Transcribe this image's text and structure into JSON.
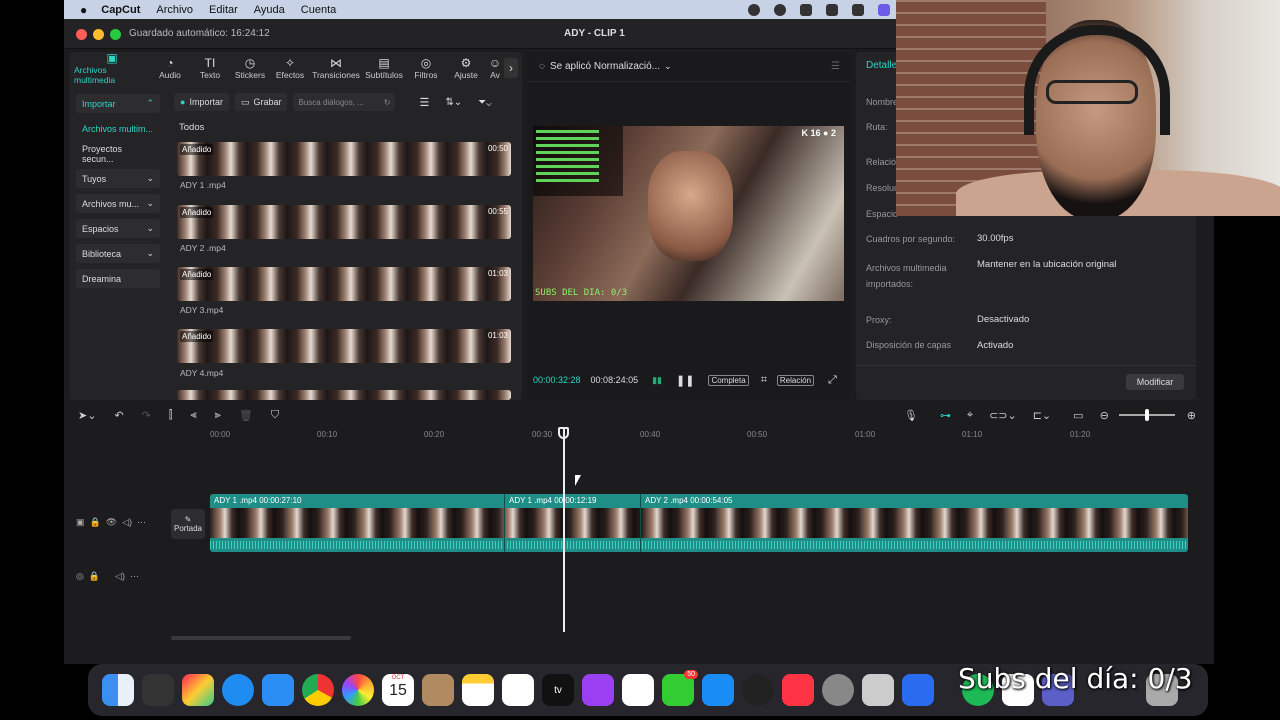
{
  "menubar": {
    "app": "CapCut",
    "items": [
      "Archivo",
      "Editar",
      "Ayuda",
      "Cuenta"
    ]
  },
  "window": {
    "autosave": "Guardado automático: 16:24:12",
    "title": "ADY - CLIP 1",
    "colors": {
      "close": "#ff5f57",
      "min": "#febc2e",
      "max": "#28c840",
      "accent": "#2fd3c5"
    }
  },
  "toolbar": {
    "items": [
      {
        "label": "Archivos multimedia",
        "icon": "media-icon",
        "glyph": "▣"
      },
      {
        "label": "Audio",
        "icon": "audio-icon",
        "glyph": "◔"
      },
      {
        "label": "Texto",
        "icon": "text-icon",
        "glyph": "TI"
      },
      {
        "label": "Stickers",
        "icon": "sticker-icon",
        "glyph": "◷"
      },
      {
        "label": "Efectos",
        "icon": "effects-icon",
        "glyph": "✧"
      },
      {
        "label": "Transiciones",
        "icon": "transitions-icon",
        "glyph": "⋈"
      },
      {
        "label": "Subtítulos",
        "icon": "subtitles-icon",
        "glyph": "▤"
      },
      {
        "label": "Filtros",
        "icon": "filters-icon",
        "glyph": "◎"
      },
      {
        "label": "Ajuste",
        "icon": "adjust-icon",
        "glyph": "⚙"
      },
      {
        "label": "Av",
        "icon": "avatar-icon",
        "glyph": "☺"
      }
    ]
  },
  "sidenav": {
    "items": [
      "Importar",
      "Archivos multim...",
      "Proyectos secun...",
      "Tuyos",
      "Archivos mu...",
      "Espacios",
      "Biblioteca",
      "Dreamina"
    ]
  },
  "media": {
    "import_label": "Importar",
    "record_label": "Grabar",
    "search_placeholder": "Busca diálogos, ...",
    "section": "Todos",
    "clips": [
      {
        "badge": "Añadido",
        "name": "ADY 1 .mp4",
        "duration": "00:50"
      },
      {
        "badge": "Añadido",
        "name": "ADY 2 .mp4",
        "duration": "00:55"
      },
      {
        "badge": "Añadido",
        "name": "ADY 3.mp4",
        "duration": "01:03"
      },
      {
        "badge": "Añadido",
        "name": "ADY 4.mp4",
        "duration": "01:03"
      }
    ]
  },
  "player": {
    "status": "Se aplicó Normalizació...",
    "current": "00:00:32:28",
    "total": "00:08:24:05",
    "full_label": "Completa",
    "ratio_label": "Relación",
    "video_subs": "SUBS DEL DIA: 0/3",
    "video_score": "K 16  ● 2"
  },
  "details": {
    "title": "Detalles",
    "rows": [
      {
        "label": "Nombre",
        "value": ""
      },
      {
        "label": "Ruta:",
        "value": ""
      },
      {
        "label": "Relación",
        "value": ""
      },
      {
        "label": "Resolución",
        "value": ""
      },
      {
        "label": "Espacio",
        "value": ""
      },
      {
        "label": "Cuadros por segundo:",
        "value": "30.00fps"
      },
      {
        "label": "Archivos multimedia importados:",
        "value": "Mantener en la ubicación original"
      },
      {
        "label": "Proxy:",
        "value": "Desactivado"
      },
      {
        "label": "Disposición de capas",
        "value": "Activado"
      }
    ],
    "modify_label": "Modificar"
  },
  "timeline": {
    "ruler": [
      "00:00",
      "00:10",
      "00:20",
      "00:30",
      "00:40",
      "00:50",
      "01:00",
      "01:10",
      "01:20"
    ],
    "segments": [
      {
        "label": "ADY 1 .mp4   00:00:27:10"
      },
      {
        "label": "ADY 1 .mp4   00:00:12:19"
      },
      {
        "label": "ADY 2 .mp4   00:00:54:05"
      }
    ],
    "cover_label": "Portada"
  },
  "dock": {
    "calendar_month": "OCT",
    "calendar_day": "15",
    "messages_badge": "50",
    "apps": [
      "finder",
      "calculator",
      "launchpad",
      "safari",
      "mail",
      "chrome",
      "photos",
      "calendar",
      "contacts",
      "notes",
      "freeform",
      "tv",
      "podcasts",
      "reminders",
      "messages",
      "appstore",
      "capcut",
      "music",
      "settings",
      "preview",
      "remote",
      "spotify",
      "capcut-2",
      "teams",
      "trash"
    ]
  },
  "overlay": {
    "subs_text": "Subs del día: 0/3"
  }
}
